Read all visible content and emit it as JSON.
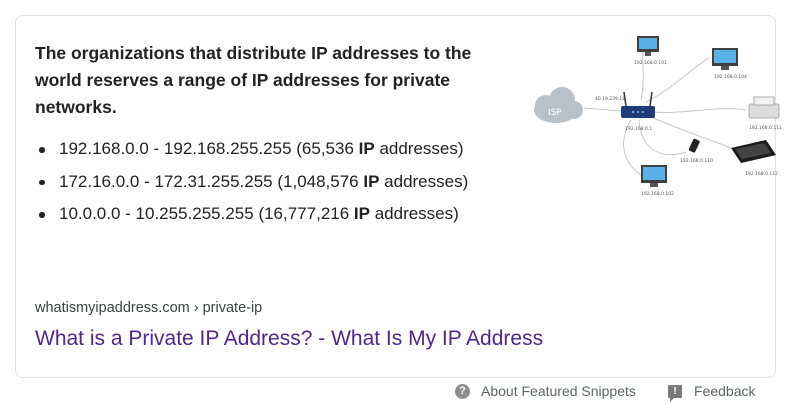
{
  "snippet": {
    "headline": "The organizations that distribute IP addresses to the world reserves a range of IP addresses for private networks.",
    "bullets": [
      {
        "text": "192.168.0.0 - 192.168.255.255 (65,536 ",
        "bold": "IP",
        "tail": " addresses)"
      },
      {
        "text": "172.16.0.0 - 172.31.255.255 (1,048,576 ",
        "bold": "IP",
        "tail": " addresses)"
      },
      {
        "text": "10.0.0.0 - 10.255.255.255 (16,777,216 ",
        "bold": "IP",
        "tail": " addresses)"
      }
    ],
    "source": "whatismyipaddress.com › private-ip",
    "title_link": "What is a Private IP Address? - What Is My IP Address",
    "link_color": "#52258f"
  },
  "diagram": {
    "cloud_label": "ISP",
    "router_ip": "192.168.0.1",
    "wan_ip": "40.19.239.18",
    "device_ips": [
      "192.168.0.101",
      "192.168.0.104",
      "192.168.0.111",
      "192.168.0.110",
      "192.168.0.102",
      "192.168.0.112"
    ],
    "router_color": "#1e3c78",
    "cloud_color": "#b9c0c9"
  },
  "footer": {
    "about_label": "About Featured Snippets",
    "feedback_label": "Feedback",
    "about_icon": "question-circle-icon",
    "feedback_icon": "feedback-flag-icon"
  }
}
